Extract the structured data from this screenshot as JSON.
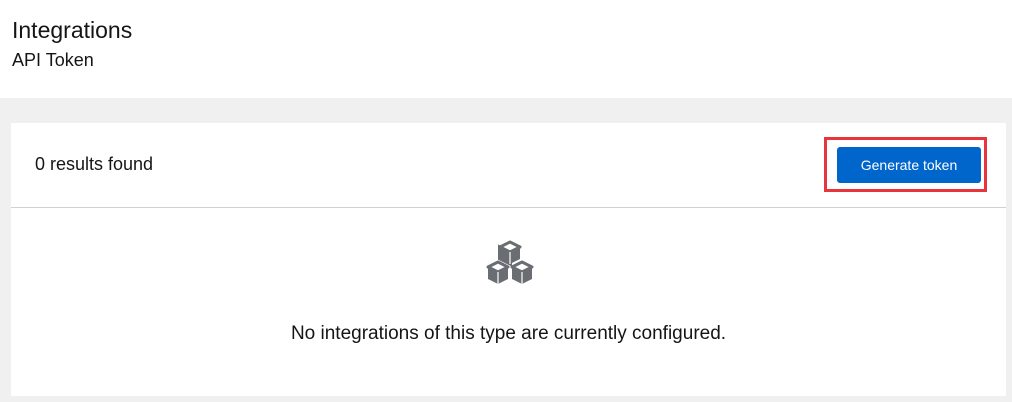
{
  "header": {
    "title": "Integrations",
    "subtitle": "API Token"
  },
  "toolbar": {
    "results_text": "0 results found",
    "generate_label": "Generate token"
  },
  "empty_state": {
    "icon": "cubes-icon",
    "message": "No integrations of this type are currently configured."
  },
  "colors": {
    "primary_button": "#0066cc",
    "highlight": "#e8353b",
    "page_background": "#f0f0f0"
  }
}
